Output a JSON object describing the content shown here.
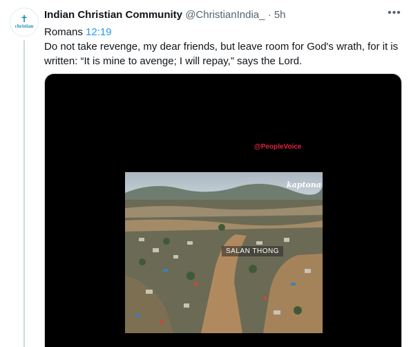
{
  "author": {
    "name": "Indian Christian Community",
    "handle": "@ChristianIndia_",
    "separator": "·",
    "time": "5h",
    "avatar_text": "christian",
    "avatar_icon": "cross-icon"
  },
  "more_label": "•••",
  "tweet": {
    "verse_book": "Romans",
    "verse_ref": "12:19",
    "text": "Do not take revenge, my dear friends, but leave room for God's wrath, for it is written: “It is mine to avenge; I will repay,” says the Lord."
  },
  "media": {
    "watermark": "@PeopleVoice",
    "corner_text": "kaptona",
    "caption": "SALAN THONG"
  },
  "colors": {
    "link": "#1d9bf0",
    "watermark": "#e0243b",
    "flood_water": "#b08a5e"
  }
}
